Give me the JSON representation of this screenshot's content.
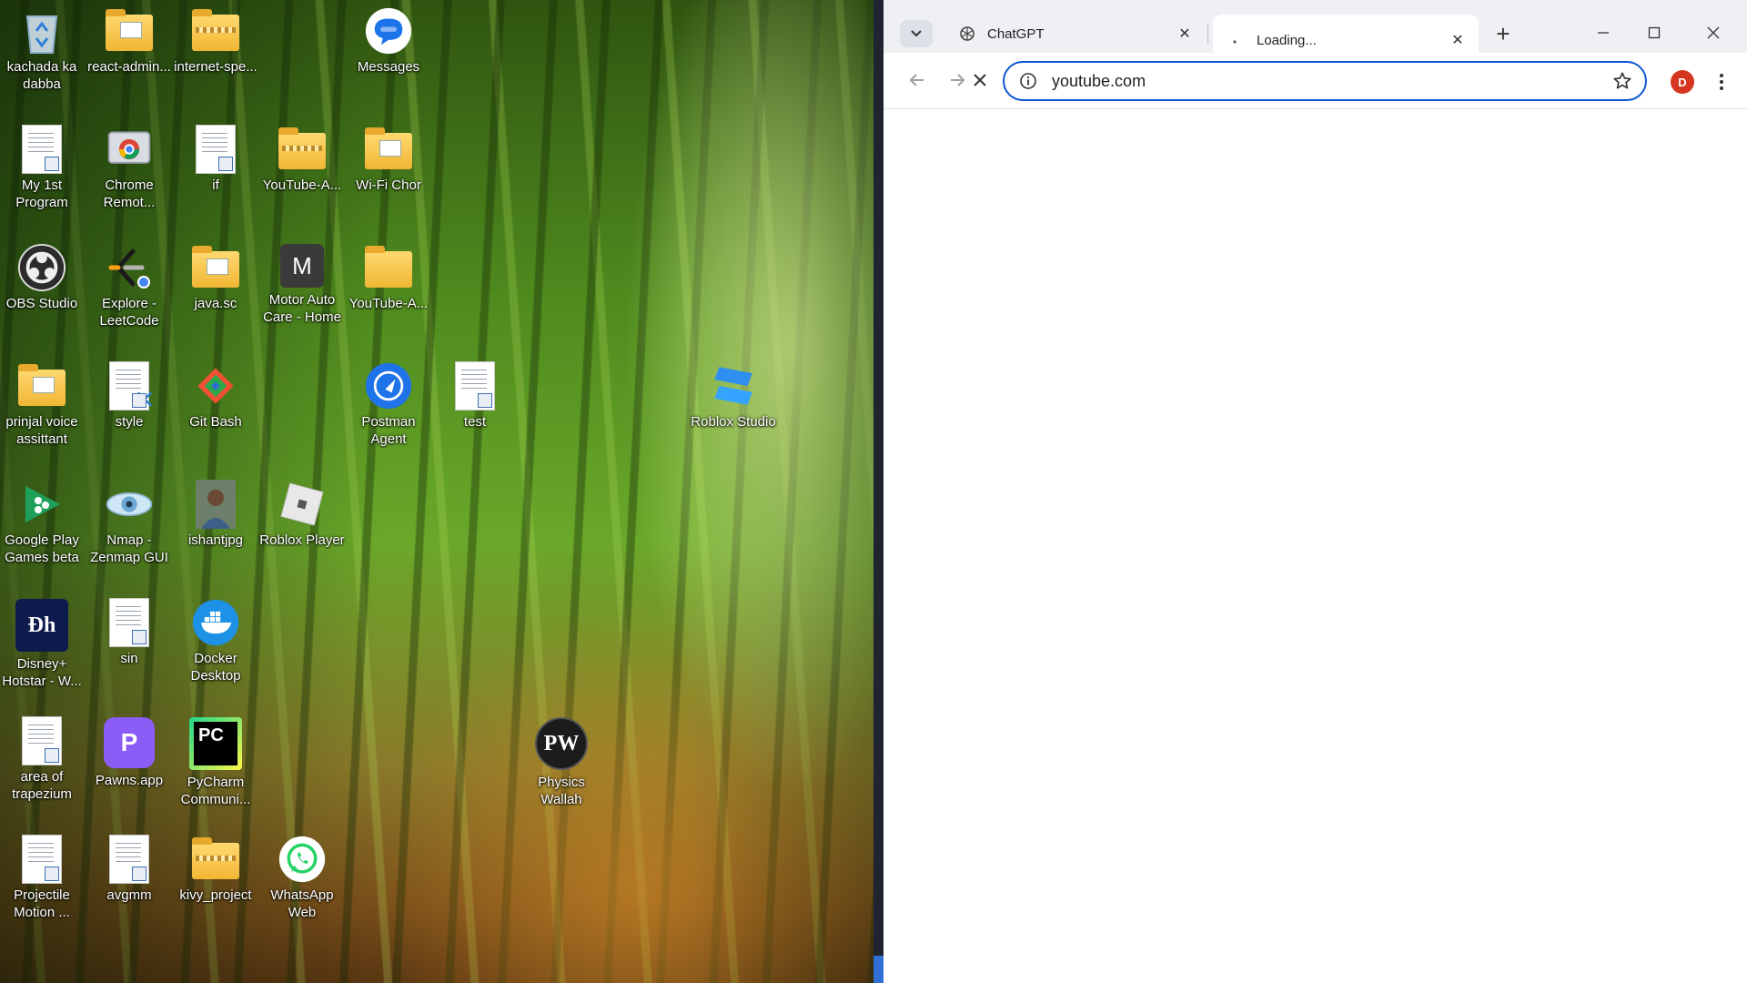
{
  "desktop": {
    "icons": [
      {
        "label": "kachada ka dabba",
        "icon": "recycle-bin-icon"
      },
      {
        "label": "react-admin...",
        "icon": "folder-icon"
      },
      {
        "label": "internet-spe...",
        "icon": "zip-folder-icon"
      },
      {
        "label": "Messages",
        "icon": "messages-icon"
      },
      {
        "label": "My 1st Program",
        "icon": "document-icon"
      },
      {
        "label": "Chrome Remot...",
        "icon": "chrome-remote-desktop-icon"
      },
      {
        "label": "if",
        "icon": "document-icon"
      },
      {
        "label": "YouTube-A...",
        "icon": "zip-folder-icon"
      },
      {
        "label": "Wi-Fi Chor",
        "icon": "folder-icon"
      },
      {
        "label": "OBS Studio",
        "icon": "obs-studio-icon"
      },
      {
        "label": "Explore - LeetCode",
        "icon": "leetcode-icon"
      },
      {
        "label": "java.sc",
        "icon": "folder-icon"
      },
      {
        "label": "Motor Auto Care - Home",
        "icon": "m-app-icon",
        "glyph": "M"
      },
      {
        "label": "YouTube-A...",
        "icon": "folder-icon"
      },
      {
        "label": "prinjal voice assittant",
        "icon": "folder-icon"
      },
      {
        "label": "style",
        "icon": "vscode-file-icon"
      },
      {
        "label": "Git Bash",
        "icon": "git-bash-icon"
      },
      {
        "label": "Postman Agent",
        "icon": "postman-icon"
      },
      {
        "label": "test",
        "icon": "document-icon"
      },
      {
        "label": "Roblox Studio",
        "icon": "roblox-studio-icon"
      },
      {
        "label": "Google Play Games beta",
        "icon": "google-play-games-icon"
      },
      {
        "label": "Nmap - Zenmap GUI",
        "icon": "nmap-eye-icon"
      },
      {
        "label": "ishantjpg",
        "icon": "photo-thumbnail-icon"
      },
      {
        "label": "Roblox Player",
        "icon": "roblox-player-icon"
      },
      {
        "label": "Disney+ Hotstar - W...",
        "icon": "hotstar-icon",
        "glyph": "Ðh"
      },
      {
        "label": "sin",
        "icon": "document-icon"
      },
      {
        "label": "Docker Desktop",
        "icon": "docker-icon"
      },
      {
        "label": "area of trapezium",
        "icon": "document-icon"
      },
      {
        "label": "Pawns.app",
        "icon": "pawns-app-icon",
        "glyph": "P"
      },
      {
        "label": "PyCharm Communi...",
        "icon": "pycharm-icon",
        "glyph": "PC"
      },
      {
        "label": "Physics Wallah",
        "icon": "physics-wallah-icon",
        "glyph": "PW"
      },
      {
        "label": "Projectile Motion ...",
        "icon": "document-icon"
      },
      {
        "label": "avgmm",
        "icon": "document-icon"
      },
      {
        "label": "kivy_project",
        "icon": "zip-folder-icon"
      },
      {
        "label": "WhatsApp Web",
        "icon": "whatsapp-icon"
      }
    ]
  },
  "browser": {
    "tabs": [
      {
        "title": "ChatGPT",
        "icon": "chatgpt-icon",
        "active": false
      },
      {
        "title": "Loading...",
        "icon": "loading-spinner-icon",
        "active": true
      }
    ],
    "address_value": "youtube.com",
    "profile_initial": "D",
    "colors": {
      "accent": "#0b57d0",
      "avatar": "#d6361f",
      "tabstrip": "#eef0f3"
    }
  }
}
